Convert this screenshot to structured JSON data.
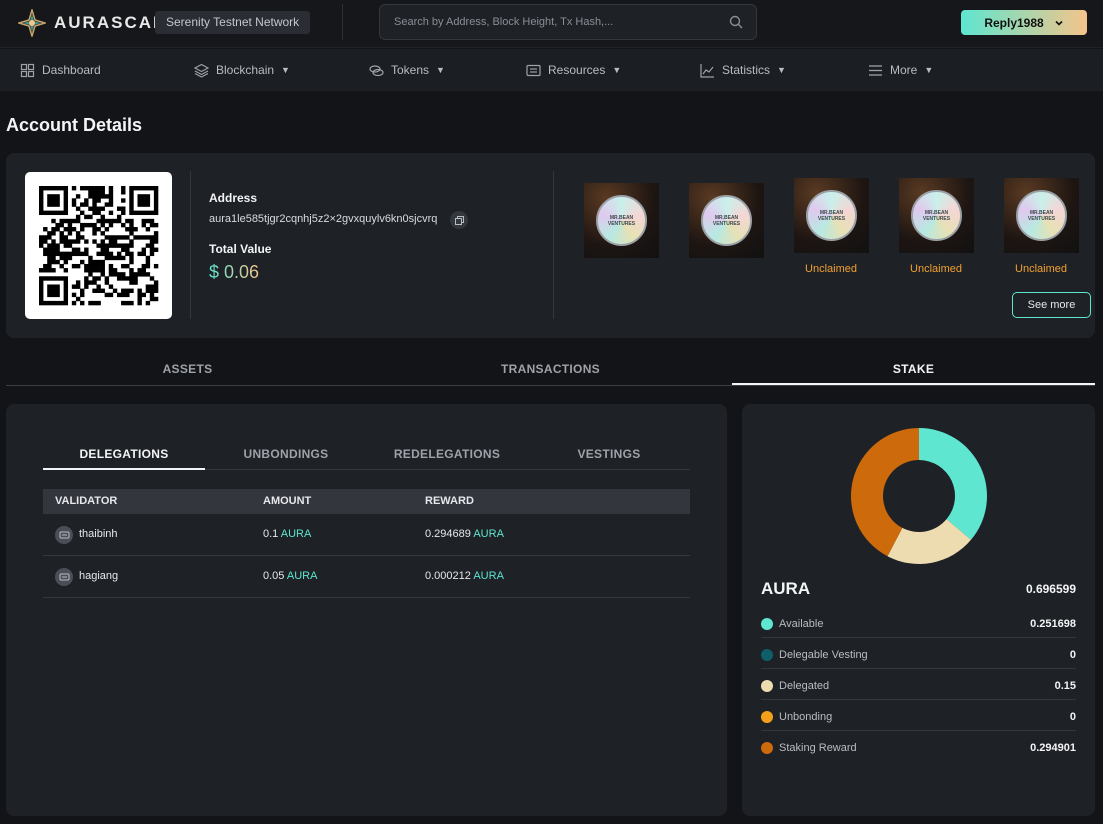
{
  "header": {
    "logo_text": "AURASCAN",
    "network": "Serenity Testnet Network",
    "search_placeholder": "Search by Address, Block Height, Tx Hash,...",
    "user": "Reply1988"
  },
  "nav": {
    "items": [
      {
        "label": "Dashboard",
        "icon": "grid-icon",
        "dropdown": false
      },
      {
        "label": "Blockchain",
        "icon": "layers-icon",
        "dropdown": true
      },
      {
        "label": "Tokens",
        "icon": "coins-icon",
        "dropdown": true
      },
      {
        "label": "Resources",
        "icon": "document-icon",
        "dropdown": true
      },
      {
        "label": "Statistics",
        "icon": "chart-icon",
        "dropdown": true
      },
      {
        "label": "More",
        "icon": "menu-icon",
        "dropdown": true
      }
    ]
  },
  "page": {
    "title": "Account Details"
  },
  "account": {
    "address_label": "Address",
    "address": "aura1le585tjgr2cqnhj5z2×2gvxquylv6kn0sjcvrq",
    "total_value_label": "Total Value",
    "total_value": "$ 0.06",
    "nfts": [
      {
        "art_text": "MR.BEAN VENTURES",
        "status": ""
      },
      {
        "art_text": "MR.BEAN VENTURES",
        "status": ""
      },
      {
        "art_text": "MR.BEAN VENTURES",
        "status": "Unclaimed"
      },
      {
        "art_text": "MR.BEAN VENTURES",
        "status": "Unclaimed"
      },
      {
        "art_text": "MR.BEAN VENTURES",
        "status": "Unclaimed"
      }
    ],
    "see_more": "See more"
  },
  "main_tabs": [
    {
      "label": "ASSETS",
      "active": false
    },
    {
      "label": "TRANSACTIONS",
      "active": false
    },
    {
      "label": "STAKE",
      "active": true
    }
  ],
  "stake": {
    "sub_tabs": [
      {
        "label": "DELEGATIONS",
        "active": true
      },
      {
        "label": "UNBONDINGS",
        "active": false
      },
      {
        "label": "REDELEGATIONS",
        "active": false
      },
      {
        "label": "VESTINGS",
        "active": false
      }
    ],
    "columns": [
      "VALIDATOR",
      "AMOUNT",
      "REWARD"
    ],
    "rows": [
      {
        "validator": "thaibinh",
        "amount": "0.1",
        "amount_unit": "AURA",
        "reward": "0.294689",
        "reward_unit": "AURA"
      },
      {
        "validator": "hagiang",
        "amount": "0.05",
        "amount_unit": "AURA",
        "reward": "0.000212",
        "reward_unit": "AURA"
      }
    ]
  },
  "balance": {
    "title": "AURA",
    "total": "0.696599",
    "items": [
      {
        "label": "Available",
        "value": "0.251698",
        "color": "#5ee6d0",
        "amount": 0.251698
      },
      {
        "label": "Delegable Vesting",
        "value": "0",
        "color": "#0f5f6a",
        "amount": 0
      },
      {
        "label": "Delegated",
        "value": "0.15",
        "color": "#ecdcb0",
        "amount": 0.15
      },
      {
        "label": "Unbonding",
        "value": "0",
        "color": "#f2a01a",
        "amount": 0
      },
      {
        "label": "Staking Reward",
        "value": "0.294901",
        "color": "#cc6a0c",
        "amount": 0.294901
      }
    ]
  }
}
